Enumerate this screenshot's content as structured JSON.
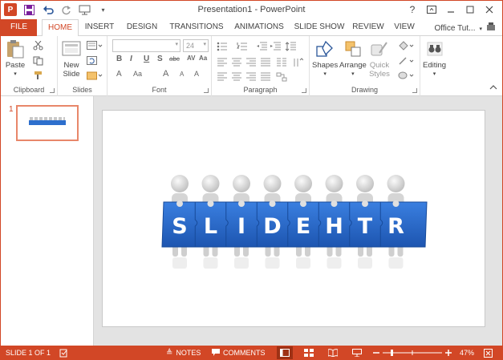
{
  "window": {
    "title": "Presentation1 - PowerPoint",
    "controls": {
      "help": "?",
      "restore": "□",
      "minimize": "—",
      "maximize": "☐",
      "close": "✕"
    }
  },
  "qat": {
    "logo": "P",
    "save_icon": "save-icon",
    "undo_icon": "undo-icon",
    "redo_icon": "redo-icon",
    "present_icon": "present-icon"
  },
  "tabs": {
    "file": "FILE",
    "items": [
      "HOME",
      "INSERT",
      "DESIGN",
      "TRANSITIONS",
      "ANIMATIONS",
      "SLIDE SHOW",
      "REVIEW",
      "VIEW"
    ],
    "active": "HOME",
    "account": "Office Tut..."
  },
  "ribbon": {
    "clipboard": {
      "label": "Clipboard",
      "paste": "Paste"
    },
    "slides": {
      "label": "Slides",
      "new_slide_line1": "New",
      "new_slide_line2": "Slide"
    },
    "font": {
      "label": "Font",
      "font_name": "",
      "font_size": "24"
    },
    "paragraph": {
      "label": "Paragraph"
    },
    "drawing": {
      "label": "Drawing",
      "shapes": "Shapes",
      "arrange": "Arrange",
      "quick_styles_line1": "Quick",
      "quick_styles_line2": "Styles"
    },
    "editing": {
      "label": "Editing"
    }
  },
  "thumbnails": {
    "slide_number": "1"
  },
  "slide": {
    "letters": [
      "S",
      "L",
      "I",
      "D",
      "E",
      "H",
      "T",
      "R"
    ]
  },
  "status": {
    "slide_info": "SLIDE 1 OF 1",
    "notes": "NOTES",
    "comments": "COMMENTS",
    "zoom": "47%"
  },
  "colors": {
    "accent": "#d24726",
    "banner": "#2d6fcd",
    "figure": "#d9d9d9"
  }
}
